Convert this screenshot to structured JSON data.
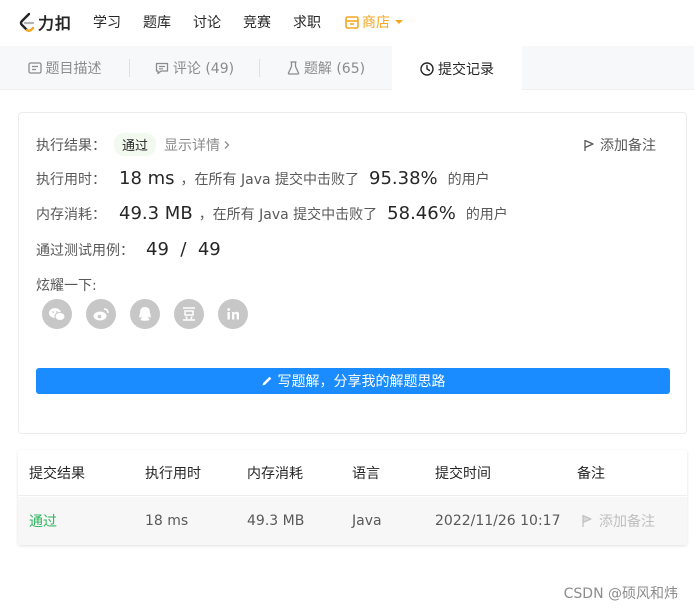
{
  "nav": {
    "logo": "力扣",
    "items": [
      "学习",
      "题库",
      "讨论",
      "竞赛",
      "求职"
    ],
    "store": "商店"
  },
  "tabs": [
    {
      "label": "题目描述"
    },
    {
      "label": "评论 (49)"
    },
    {
      "label": "题解 (65)"
    },
    {
      "label": "提交记录"
    }
  ],
  "result": {
    "status_label": "执行结果：",
    "status": "通过",
    "detail_link": "显示详情",
    "add_note": "添加备注",
    "time_label": "执行用时：",
    "time_value": "18 ms",
    "time_mid": "，在所有 Java 提交中击败了",
    "time_percent": "95.38%",
    "time_suffix": "的用户",
    "mem_label": "内存消耗：",
    "mem_value": "49.3 MB",
    "mem_mid": "，在所有 Java 提交中击败了",
    "mem_percent": "58.46%",
    "mem_suffix": "的用户",
    "cases_label": "通过测试用例：",
    "cases_value": "49  /  49",
    "share_label": "炫耀一下:",
    "write_button": "写题解，分享我的解题思路"
  },
  "table": {
    "headers": [
      "提交结果",
      "执行用时",
      "内存消耗",
      "语言",
      "提交时间",
      "备注"
    ],
    "rows": [
      {
        "status": "通过",
        "time": "18 ms",
        "memory": "49.3 MB",
        "lang": "Java",
        "submitted": "2022/11/26 10:17",
        "note": "添加备注"
      }
    ]
  },
  "watermark": "CSDN @硕风和炜",
  "colors": {
    "accent": "#1a8cff",
    "pass": "#2db55d",
    "store": "#f5a623"
  },
  "icons": {
    "logo": "leetcode-logo",
    "store": "store-icon",
    "tab_desc": "description-icon",
    "tab_comments": "comment-icon",
    "tab_solutions": "flask-icon",
    "tab_submissions": "clock-icon",
    "add_note": "flag-icon",
    "share": [
      "wechat-icon",
      "weibo-icon",
      "qq-icon",
      "douban-icon",
      "linkedin-icon"
    ],
    "write": "pencil-icon"
  }
}
